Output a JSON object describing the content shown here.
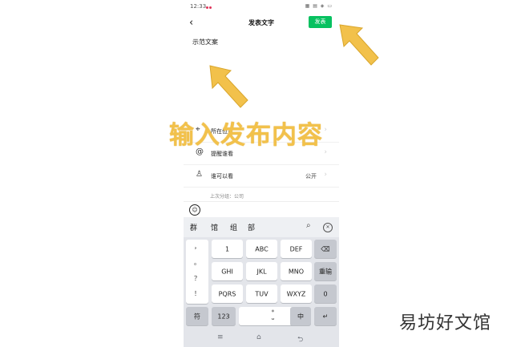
{
  "status_bar": {
    "time": "12:33",
    "dot_colors": [
      "#e0345a",
      "#e0345a"
    ],
    "icons_text": "▦ ▤ ◈ ▭"
  },
  "navbar": {
    "back_icon": "back-chevron-icon",
    "title": "发表文字",
    "publish_label": "发表",
    "accent": "#07c160"
  },
  "compose": {
    "text": "示范文案"
  },
  "options": [
    {
      "icon": "location-pin-icon",
      "glyph": "⌖",
      "label": "所在位置",
      "value": ""
    },
    {
      "icon": "at-sign-icon",
      "glyph": "@",
      "label": "提醒谁看",
      "value": ""
    },
    {
      "icon": "person-icon",
      "glyph": "♙",
      "label": "谁可以看",
      "value": "公开"
    }
  ],
  "group_hint": "上次分组：公司",
  "keyboard": {
    "candidates": [
      "群",
      "馆",
      "组",
      "部"
    ],
    "punctuation": [
      "，",
      "。",
      "？",
      "！"
    ],
    "rows": [
      [
        {
          "label": "1"
        },
        {
          "label": "ABC"
        },
        {
          "label": "DEF"
        }
      ],
      [
        {
          "label": "GHI"
        },
        {
          "label": "JKL"
        },
        {
          "label": "MNO"
        }
      ],
      [
        {
          "label": "PQRS"
        },
        {
          "label": "TUV"
        },
        {
          "label": "WXYZ"
        }
      ]
    ],
    "right_keys": [
      "⌫",
      "重输",
      "0"
    ],
    "bottom_keys": {
      "symbols": "符",
      "numbers": "123",
      "space": "⎵",
      "lang": "中",
      "enter": "↵"
    }
  },
  "annotation": {
    "text": "输入发布内容",
    "color": "#f2c14b"
  },
  "watermark": {
    "text": "易坊好文馆"
  }
}
